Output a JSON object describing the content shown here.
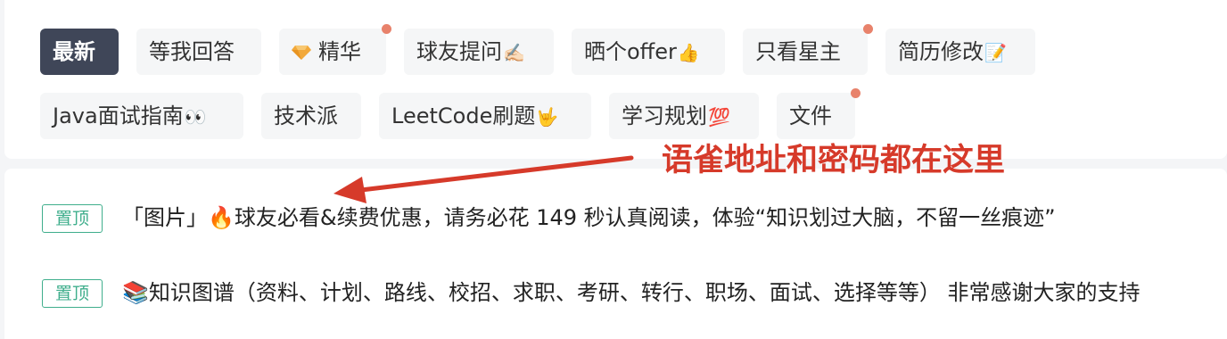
{
  "filters": {
    "items": [
      {
        "label": "最新",
        "emoji": "",
        "dot": false,
        "active": true
      },
      {
        "label": "等我回答",
        "emoji": "",
        "dot": false,
        "active": false
      },
      {
        "label": "精华",
        "emoji": "",
        "dot": true,
        "active": false,
        "icon": "diamond-icon"
      },
      {
        "label": "球友提问",
        "emoji": "✍🏻",
        "dot": false,
        "active": false
      },
      {
        "label": "晒个offer",
        "emoji": "👍",
        "dot": false,
        "active": false
      },
      {
        "label": "只看星主",
        "emoji": "",
        "dot": true,
        "active": false
      },
      {
        "label": "简历修改",
        "emoji": "📝",
        "dot": false,
        "active": false
      },
      {
        "label": "Java面试指南",
        "emoji": "👀",
        "dot": false,
        "active": false
      },
      {
        "label": "技术派",
        "emoji": "",
        "dot": false,
        "active": false
      },
      {
        "label": "LeetCode刷题",
        "emoji": "🤟",
        "dot": false,
        "active": false
      },
      {
        "label": "学习规划",
        "emoji": "💯",
        "dot": false,
        "active": false
      },
      {
        "label": "文件",
        "emoji": "",
        "dot": true,
        "active": false
      }
    ],
    "dot_color": "#e8826b",
    "active_bg": "#3f4658"
  },
  "posts": [
    {
      "badge": "置顶",
      "title": "「图片」🔥球友必看&续费优惠，请务必花 149 秒认真阅读，体验“知识划过大脑，不留一丝痕迹”"
    },
    {
      "badge": "置顶",
      "title": "📚知识图谱（资料、计划、路线、校招、求职、考研、转行、职场、面试、选择等等） 非常感谢大家的支持"
    }
  ],
  "annotation": {
    "text": "语雀地址和密码都在这里",
    "color": "#d63a2a"
  }
}
